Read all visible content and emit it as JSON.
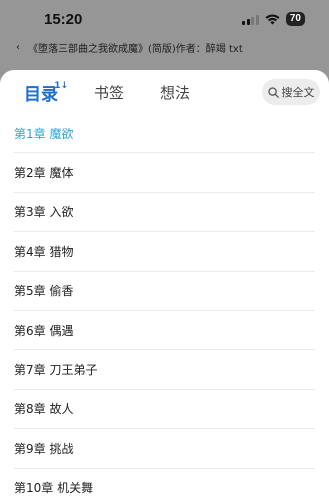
{
  "status": {
    "time": "15:20",
    "battery": "70"
  },
  "background": {
    "title": "《堕落三部曲之我欲成魔》(简版)作者：醉竭 txt"
  },
  "tabs": [
    {
      "label": "目录",
      "marker": "1↓"
    },
    {
      "label": "书签"
    },
    {
      "label": "想法"
    }
  ],
  "search": {
    "label": "搜全文"
  },
  "chapters": [
    {
      "label": "第1章 魔欲"
    },
    {
      "label": "第2章 魔体"
    },
    {
      "label": "第3章 入欲"
    },
    {
      "label": "第4章 猎物"
    },
    {
      "label": "第5章 偷香"
    },
    {
      "label": "第6章 偶遇"
    },
    {
      "label": "第7章 刀王弟子"
    },
    {
      "label": "第8章 故人"
    },
    {
      "label": "第9章 挑战"
    },
    {
      "label": "第10章 机关舞"
    }
  ],
  "colors": {
    "accent": "#1a6fd1",
    "current_chapter": "#2aa7d8"
  }
}
